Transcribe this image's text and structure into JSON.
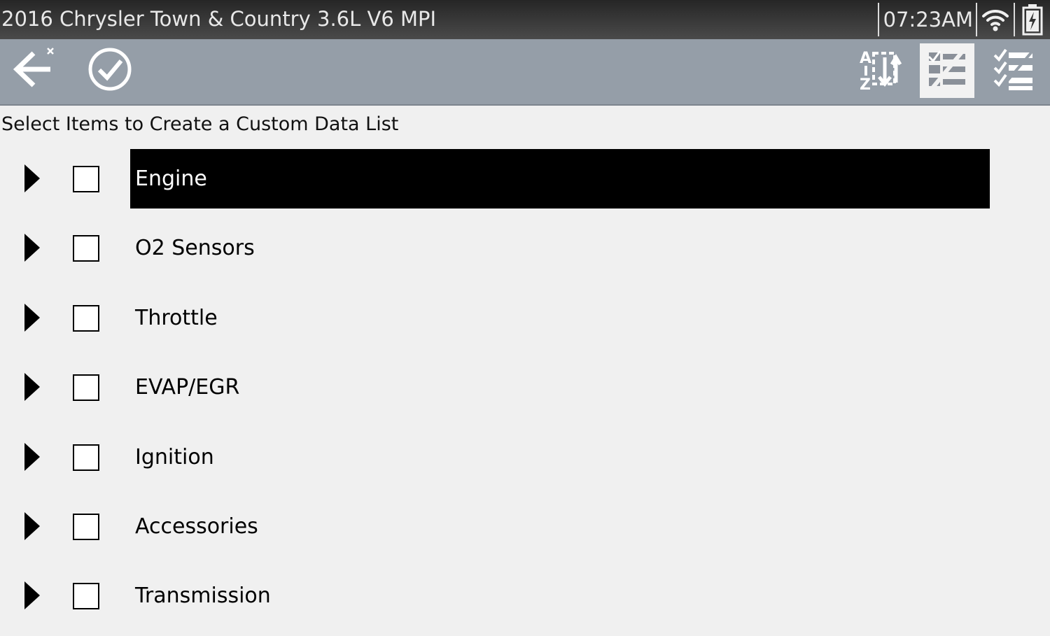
{
  "status_bar": {
    "vehicle": "2016 Chrysler Town & Country 3.6L V6 MPI",
    "time": "07:23AM",
    "wifi_icon": "wifi-icon",
    "battery_icon": "battery-charging-icon"
  },
  "toolbar": {
    "buttons": [
      {
        "icon": "back-exit-icon"
      },
      {
        "icon": "accept-check-icon"
      },
      {
        "icon": "sort-az-icon"
      },
      {
        "icon": "select-deselect-icon",
        "active": true
      },
      {
        "icon": "select-all-icon"
      }
    ]
  },
  "instruction": "Select Items to Create a Custom Data List",
  "list": {
    "items": [
      {
        "label": "Engine",
        "selected": true
      },
      {
        "label": "O2 Sensors"
      },
      {
        "label": "Throttle"
      },
      {
        "label": "EVAP/EGR"
      },
      {
        "label": "Ignition"
      },
      {
        "label": "Accessories"
      },
      {
        "label": "Transmission"
      }
    ]
  },
  "colors": {
    "toolbar": "#959ea8",
    "background": "#f0f0f0",
    "highlight": "#000000",
    "status_bar": "#3a3a3a"
  }
}
